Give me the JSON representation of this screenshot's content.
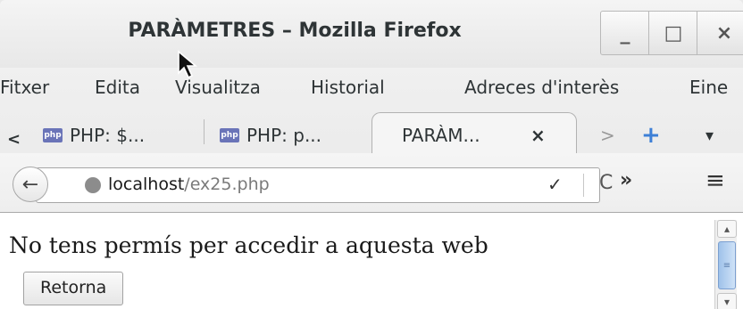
{
  "window": {
    "title": "PARÀMETRES – Mozilla Firefox",
    "minimize_glyph": "_",
    "maximize_glyph": "□",
    "close_glyph": "×"
  },
  "menubar": {
    "items": [
      "Fitxer",
      "Edita",
      "Visualitza",
      "Historial",
      "Adreces d'interès",
      "Eine"
    ]
  },
  "tabs": {
    "scroll_left": "<",
    "items": [
      {
        "label": "PHP: $...",
        "icon": "php-icon"
      },
      {
        "label": "PHP: p...",
        "icon": "php-icon"
      },
      {
        "label": "PARÀM...",
        "close": "×",
        "active": true
      }
    ],
    "scroll_right": ">",
    "new_tab": "+",
    "list_tabs": "▾"
  },
  "navbar": {
    "url_host": "localhost",
    "url_path": "/ex25.php",
    "dropdown_glyph": "✓",
    "reload_glyph": "C",
    "overflow_glyph": "»",
    "menu_glyph": "≡"
  },
  "content": {
    "message": "No tens permís per accedir a aquesta web",
    "button_label": "Retorna"
  }
}
